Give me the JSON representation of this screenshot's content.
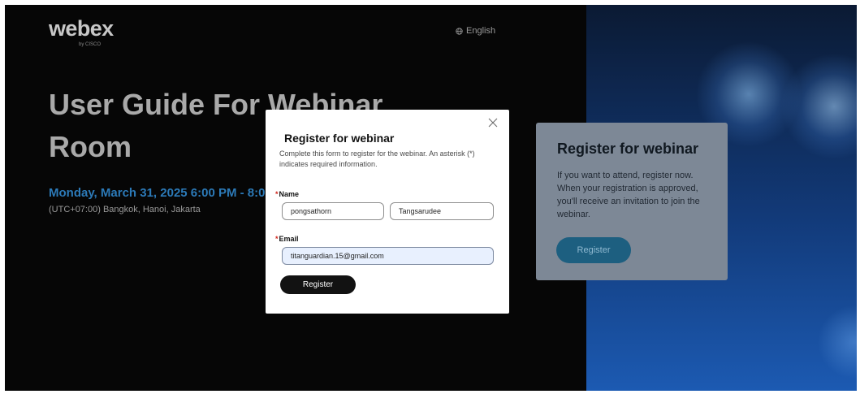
{
  "header": {
    "logo_text": "webex",
    "logo_subtext": "by CISCO",
    "language_label": "English",
    "language_icon": "globe-icon"
  },
  "event": {
    "title": "User Guide For Webinar Room",
    "date_time": "Monday, March 31, 2025 6:00 PM - 8:0",
    "timezone": "(UTC+07:00) Bangkok, Hanoi, Jakarta"
  },
  "register_card": {
    "title": "Register for webinar",
    "description": "If you want to attend, register now. When your registration is approved, you'll receive an invitation to join the webinar.",
    "button_label": "Register"
  },
  "dialog": {
    "title": "Register for webinar",
    "description": "Complete this form to register for the webinar. An asterisk (*) indicates required information.",
    "close_icon": "close-icon",
    "required_mark": "*",
    "name_label": "Name",
    "first_name_value": "pongsathorn",
    "last_name_value": "Tangsarudee",
    "email_label": "Email",
    "email_value": "titanguardian.15@gmail.com",
    "submit_label": "Register"
  },
  "colors": {
    "page_background": "#060606",
    "date_accent": "#2c7ab8",
    "card_background": "#7d8896",
    "card_button": "#1d5f80",
    "required_mark": "#d0271d",
    "submit_button": "#121212",
    "autofill_background": "#e8f0fe"
  }
}
